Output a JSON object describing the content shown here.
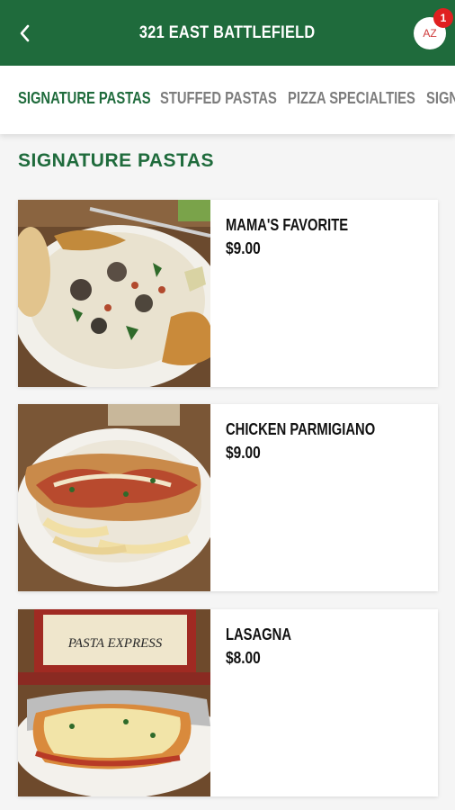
{
  "header": {
    "title": "321 EAST BATTLEFIELD",
    "avatar_initials": "AZ",
    "badge_count": "1"
  },
  "tabs": [
    {
      "label": "SIGNATURE PASTAS",
      "active": true
    },
    {
      "label": "STUFFED PASTAS",
      "active": false
    },
    {
      "label": "PIZZA SPECIALTIES",
      "active": false
    },
    {
      "label": "SIGN",
      "active": false
    }
  ],
  "section": {
    "title": "SIGNATURE PASTAS"
  },
  "items": [
    {
      "name": "MAMA'S FAVORITE",
      "price": "$9.00"
    },
    {
      "name": "CHICKEN PARMIGIANO",
      "price": "$9.00"
    },
    {
      "name": "LASAGNA",
      "price": "$8.00"
    }
  ],
  "images": {
    "item2_sign_text": "PASTA EXPRESS"
  },
  "colors": {
    "brand_green": "#1f6b3c",
    "badge_red": "#e02020",
    "inactive_tab": "#7d7d7d"
  },
  "icons": {
    "back": "chevron-left-icon"
  }
}
